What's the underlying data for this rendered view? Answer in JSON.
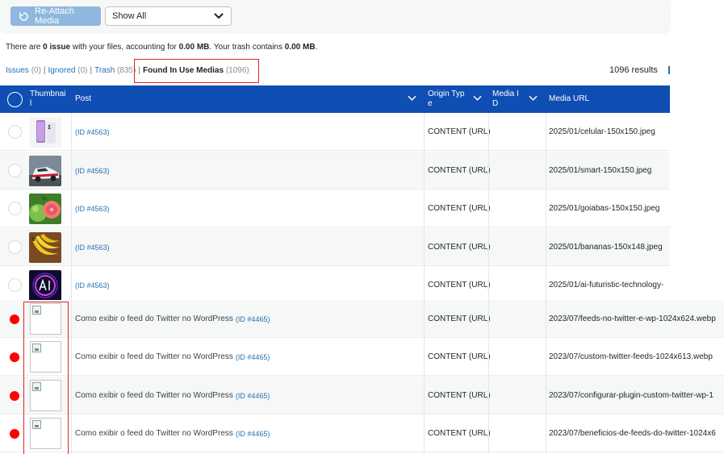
{
  "toolbar": {
    "reattach_label": "Re-Attach Media",
    "filter_value": "Show All"
  },
  "summary": {
    "prefix": "There are ",
    "issue_count": "0 issue",
    "middle": " with your files, accounting for ",
    "size": "0.00 MB",
    "trash_text": ". Your trash contains ",
    "trash_size": "0.00 MB",
    "suffix": "."
  },
  "tabs": [
    {
      "label": "Issues",
      "count": "(0)"
    },
    {
      "label": "Ignored",
      "count": "(0)"
    },
    {
      "label": "Trash",
      "count": "(835)"
    },
    {
      "label": "Found In Use Medias",
      "count": "(1096)"
    }
  ],
  "results_label": "1096 results",
  "table": {
    "headers": {
      "thumbnail_l1": "Thumbnai",
      "thumbnail_l2": "l",
      "post": "Post",
      "origin_l1": "Origin Typ",
      "origin_l2": "e",
      "media_id_l1": "Media I",
      "media_id_l2": "D",
      "media_url": "Media URL"
    },
    "rows": [
      {
        "post_title": "",
        "post_id": "(ID #4563)",
        "origin": "CONTENT (URL)",
        "media_id": "",
        "url": "2025/01/celular-150x150.jpeg",
        "thumb": "phone-photo",
        "issue": false
      },
      {
        "post_title": "",
        "post_id": "(ID #4563)",
        "origin": "CONTENT (URL)",
        "media_id": "",
        "url": "2025/01/smart-150x150.jpeg",
        "thumb": "car-photo",
        "issue": false
      },
      {
        "post_title": "",
        "post_id": "(ID #4563)",
        "origin": "CONTENT (URL)",
        "media_id": "",
        "url": "2025/01/goiabas-150x150.jpeg",
        "thumb": "guava-photo",
        "issue": false
      },
      {
        "post_title": "",
        "post_id": "(ID #4563)",
        "origin": "CONTENT (URL)",
        "media_id": "",
        "url": "2025/01/bananas-150x148.jpeg",
        "thumb": "banana-photo",
        "issue": false
      },
      {
        "post_title": "",
        "post_id": "(ID #4563)",
        "origin": "CONTENT (URL)",
        "media_id": "",
        "url": "2025/01/ai-futuristic-technology-",
        "thumb": "ai-photo",
        "issue": false
      },
      {
        "post_title": "Como exibir o feed do Twitter no WordPress",
        "post_id": "(ID #4465)",
        "origin": "CONTENT (URL)",
        "media_id": "",
        "url": "2023/07/feeds-no-twitter-e-wp-1024x624.webp",
        "thumb": "broken-image",
        "issue": true
      },
      {
        "post_title": "Como exibir o feed do Twitter no WordPress",
        "post_id": "(ID #4465)",
        "origin": "CONTENT (URL)",
        "media_id": "",
        "url": "2023/07/custom-twitter-feeds-1024x613.webp",
        "thumb": "broken-image",
        "issue": true
      },
      {
        "post_title": "Como exibir o feed do Twitter no WordPress",
        "post_id": "(ID #4465)",
        "origin": "CONTENT (URL)",
        "media_id": "",
        "url": "2023/07/configurar-plugin-custom-twitter-wp-1",
        "thumb": "broken-image",
        "issue": true
      },
      {
        "post_title": "Como exibir o feed do Twitter no WordPress",
        "post_id": "(ID #4465)",
        "origin": "CONTENT (URL)",
        "media_id": "",
        "url": "2023/07/beneficios-de-feeds-do-twitter-1024x6",
        "thumb": "broken-image",
        "issue": true
      }
    ]
  },
  "colors": {
    "header_bg": "#0f4fb3",
    "link": "#2271b1",
    "issue_dot": "#ff0000",
    "highlight_border": "#e02424",
    "button_bg": "#8fb8de"
  }
}
